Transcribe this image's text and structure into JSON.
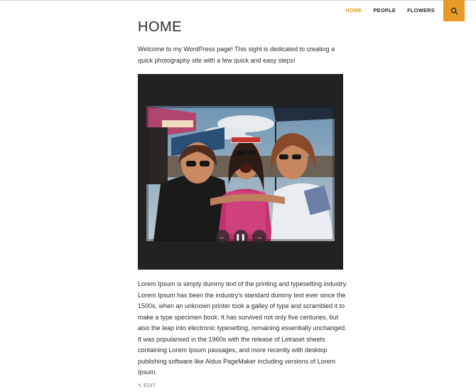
{
  "nav": {
    "items": [
      {
        "label": "HOME",
        "active": true
      },
      {
        "label": "PEOPLE",
        "active": false
      },
      {
        "label": "FLOWERS",
        "active": false
      }
    ],
    "search_icon": "search-icon",
    "accent": "#e79b26"
  },
  "page": {
    "title": "HOME",
    "intro": "Welcome to my WordPress page! This sight is dedicated to creating a quick photography site with a few quick and easy steps!",
    "body": "Lorem Ipsum is simply dummy text of the printing and typesetting industry. Lorem Ipsum has been the industry's standard dummy text ever since the 1500s, when an unknown printer took a galley of type and scrambled it to make a type specimen book. It has survived not only five centuries, but also the leap into electronic typesetting, remaining essentially unchanged. It was popularised in the 1960s with the release of Letraset sheets containing Lorem Ipsum passages, and more recently with desktop publishing software like Aldus PageMaker including versions of Lorem Ipsum.",
    "edit_label": "EDIT"
  },
  "slider": {
    "prev_icon": "arrow-left-icon",
    "pause_icon": "pause-icon",
    "next_icon": "arrow-right-icon",
    "background": "#222222"
  }
}
